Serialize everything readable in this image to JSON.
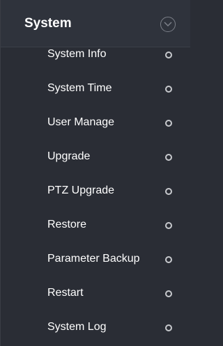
{
  "header": {
    "title": "System",
    "toggle_icon": "chevron-circle-down-icon"
  },
  "menu": {
    "item_icon": "circle-outline-icon",
    "items": [
      {
        "label": "System Info"
      },
      {
        "label": "System Time"
      },
      {
        "label": "User Manage"
      },
      {
        "label": "Upgrade"
      },
      {
        "label": "PTZ Upgrade"
      },
      {
        "label": "Restore"
      },
      {
        "label": "Parameter Backup"
      },
      {
        "label": "Restart"
      },
      {
        "label": "System Log"
      }
    ]
  },
  "colors": {
    "background": "#2a2d35",
    "header_background": "#2f333c",
    "text": "#ffffff",
    "icon": "#c7c9cd"
  }
}
